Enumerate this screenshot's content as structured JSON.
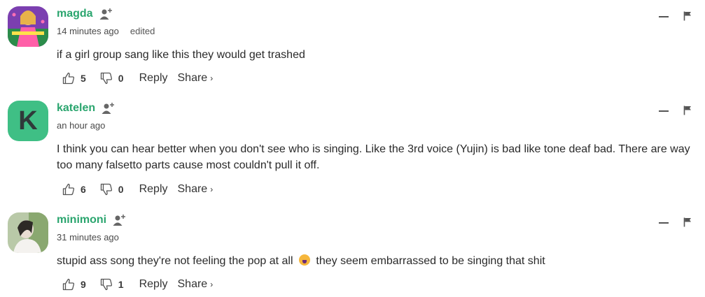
{
  "comments": [
    {
      "username": "magda",
      "time": "14 minutes ago",
      "edited": "edited",
      "text_parts": [
        "if a girl group sang like this they would get trashed"
      ],
      "likes": "5",
      "dislikes": "0",
      "reply_label": "Reply",
      "share_label": "Share",
      "share_chevron": "›",
      "avatar": "photo-magazine-icon"
    },
    {
      "username": "katelen",
      "time": "an hour ago",
      "avatar_letter": "K",
      "text_parts": [
        "I think you can hear better when you don't see who is singing. Like the 3rd voice (Yujin) is bad like tone deaf bad. There are way too many falsetto parts cause most couldn't pull it off."
      ],
      "likes": "6",
      "dislikes": "0",
      "reply_label": "Reply",
      "share_label": "Share",
      "share_chevron": "›",
      "avatar_color": "#3fbf85"
    },
    {
      "username": "minimoni",
      "time": "31 minutes ago",
      "text_parts": [
        "stupid ass song they're not feeling the pop at all",
        "they seem embarrassed to be singing that shit"
      ],
      "emoji": "crying-face-emoji",
      "likes": "9",
      "dislikes": "1",
      "reply_label": "Reply",
      "share_label": "Share",
      "share_chevron": "›",
      "avatar": "photo-person-icon"
    }
  ],
  "colors": {
    "username": "#2aa56e",
    "accent": "#3fbf85"
  }
}
